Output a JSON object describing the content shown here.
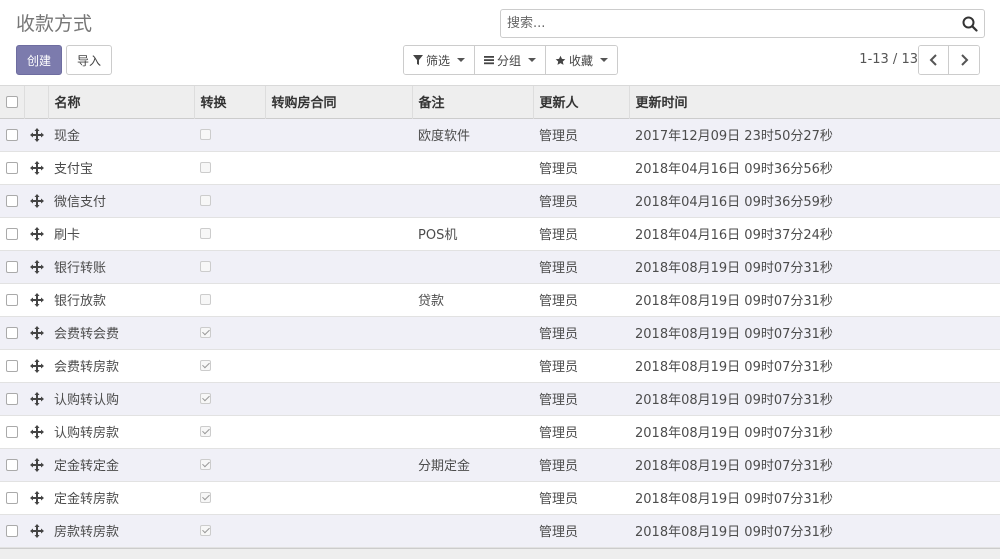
{
  "header": {
    "title": "收款方式",
    "search_placeholder": "搜索...",
    "create_label": "创建",
    "import_label": "导入",
    "filter_label": "筛选",
    "group_label": "分组",
    "favorites_label": "收藏",
    "pager_text": "1-13 / 13"
  },
  "table": {
    "columns": [
      "名称",
      "转换",
      "转购房合同",
      "备注",
      "更新人",
      "更新时间"
    ],
    "rows": [
      {
        "name": "现金",
        "convert": false,
        "contract": "",
        "note": "欧度软件",
        "updater": "管理员",
        "updated": "2017年12月09日 23时50分27秒"
      },
      {
        "name": "支付宝",
        "convert": false,
        "contract": "",
        "note": "",
        "updater": "管理员",
        "updated": "2018年04月16日 09时36分56秒"
      },
      {
        "name": "微信支付",
        "convert": false,
        "contract": "",
        "note": "",
        "updater": "管理员",
        "updated": "2018年04月16日 09时36分59秒"
      },
      {
        "name": "刷卡",
        "convert": false,
        "contract": "",
        "note": "POS机",
        "updater": "管理员",
        "updated": "2018年04月16日 09时37分24秒"
      },
      {
        "name": "银行转账",
        "convert": false,
        "contract": "",
        "note": "",
        "updater": "管理员",
        "updated": "2018年08月19日 09时07分31秒"
      },
      {
        "name": "银行放款",
        "convert": false,
        "contract": "",
        "note": "贷款",
        "updater": "管理员",
        "updated": "2018年08月19日 09时07分31秒"
      },
      {
        "name": "会费转会费",
        "convert": true,
        "contract": "",
        "note": "",
        "updater": "管理员",
        "updated": "2018年08月19日 09时07分31秒"
      },
      {
        "name": "会费转房款",
        "convert": true,
        "contract": "",
        "note": "",
        "updater": "管理员",
        "updated": "2018年08月19日 09时07分31秒"
      },
      {
        "name": "认购转认购",
        "convert": true,
        "contract": "",
        "note": "",
        "updater": "管理员",
        "updated": "2018年08月19日 09时07分31秒"
      },
      {
        "name": "认购转房款",
        "convert": true,
        "contract": "",
        "note": "",
        "updater": "管理员",
        "updated": "2018年08月19日 09时07分31秒"
      },
      {
        "name": "定金转定金",
        "convert": true,
        "contract": "",
        "note": "分期定金",
        "updater": "管理员",
        "updated": "2018年08月19日 09时07分31秒"
      },
      {
        "name": "定金转房款",
        "convert": true,
        "contract": "",
        "note": "",
        "updater": "管理员",
        "updated": "2018年08月19日 09时07分31秒"
      },
      {
        "name": "房款转房款",
        "convert": true,
        "contract": "",
        "note": "",
        "updater": "管理员",
        "updated": "2018年08月19日 09时07分31秒"
      }
    ]
  },
  "colors": {
    "primary": "#7c7bad",
    "row_alt": "#f0f0f7"
  }
}
